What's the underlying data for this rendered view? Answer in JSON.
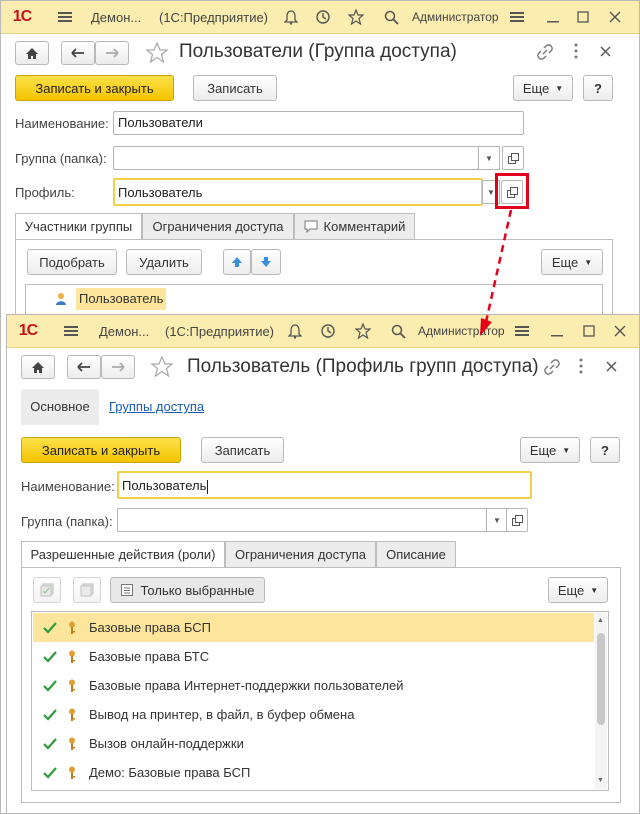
{
  "back_window": {
    "titlebar": {
      "logo": "1С",
      "app_title": "Демон...",
      "product": "(1С:Предприятие)",
      "user": "Администратор"
    },
    "header": {
      "title": "Пользователи (Группа доступа)"
    },
    "toolbar": {
      "save_close": "Записать и закрыть",
      "save": "Записать",
      "more": "Еще",
      "help": "?"
    },
    "fields": {
      "name_label": "Наименование:",
      "name_value": "Пользователи",
      "group_label": "Группа (папка):",
      "group_value": "",
      "profile_label": "Профиль:",
      "profile_value": "Пользователь"
    },
    "tabs": [
      "Участники группы",
      "Ограничения доступа",
      "Комментарий"
    ],
    "members_toolbar": {
      "pick": "Подобрать",
      "delete": "Удалить",
      "more": "Еще"
    },
    "members": [
      "Пользователь"
    ]
  },
  "front_window": {
    "titlebar": {
      "logo": "1С",
      "app_title": "Демон...",
      "product": "(1С:Предприятие)",
      "user": "Администратор"
    },
    "header": {
      "title": "Пользователь (Профиль групп доступа)"
    },
    "nav": {
      "main": "Основное",
      "groups": "Группы доступа"
    },
    "toolbar": {
      "save_close": "Записать и закрыть",
      "save": "Записать",
      "more": "Еще",
      "help": "?"
    },
    "fields": {
      "name_label": "Наименование:",
      "name_value": "Пользователь",
      "group_label": "Группа (папка):",
      "group_value": ""
    },
    "tabs": [
      "Разрешенные действия (роли)",
      "Ограничения доступа",
      "Описание"
    ],
    "roles_toolbar": {
      "only_selected": "Только выбранные",
      "more": "Еще"
    },
    "roles": [
      "Базовые права БСП",
      "Базовые права БТС",
      "Базовые права Интернет-поддержки пользователей",
      "Вывод на принтер, в файл, в буфер обмена",
      "Вызов онлайн-поддержки",
      "Демо: Базовые права БСП"
    ]
  },
  "colors": {
    "accent": "#f4c400",
    "highlight": "#fde59b",
    "titlebar": "#fbedb0",
    "callout": "#e3001b",
    "check": "#2e9b3a"
  }
}
